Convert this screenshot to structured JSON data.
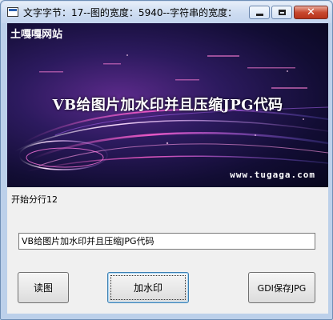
{
  "window": {
    "title": "文字字节：17--图的宽度：5940--字符串的宽度："
  },
  "picture": {
    "site_name": "土嘎嘎网站",
    "banner": "VB给图片加水印并且压缩JPG代码",
    "url": "www.tugaga.com"
  },
  "status_label": "开始分行12",
  "text_input": {
    "value": "VB给图片加水印并且压缩JPG代码"
  },
  "buttons": {
    "read": "读图",
    "watermark": "加水印",
    "gdi_save": "GDI保存JPG"
  }
}
